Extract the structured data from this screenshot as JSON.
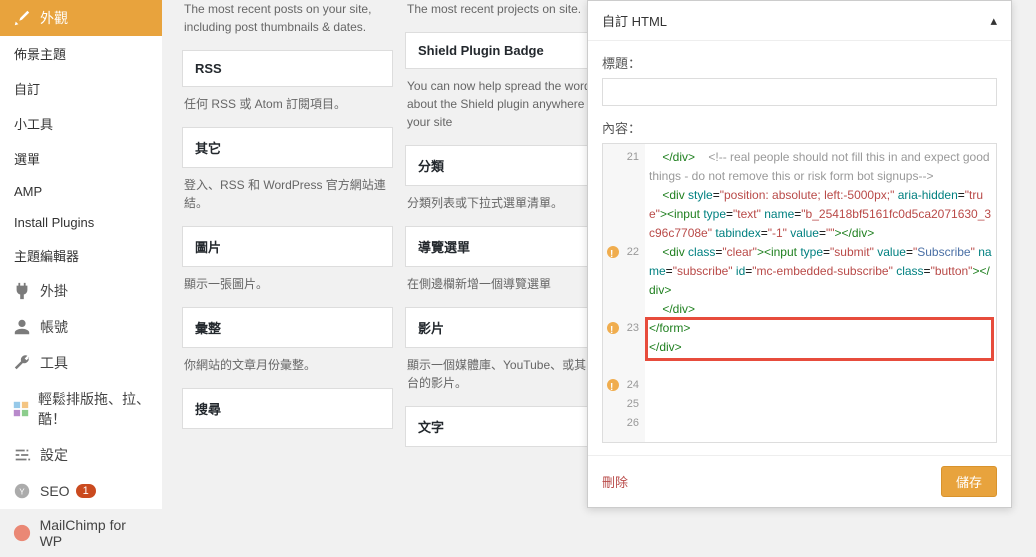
{
  "sidebar": {
    "appearance": "外觀",
    "sub": [
      "佈景主題",
      "自訂",
      "小工具",
      "選單",
      "AMP",
      "Install Plugins",
      "主題編輯器"
    ],
    "items": [
      {
        "icon": "plug",
        "label": "外掛"
      },
      {
        "icon": "user",
        "label": "帳號"
      },
      {
        "icon": "wrench",
        "label": "工具"
      },
      {
        "icon": "layout",
        "label": "輕鬆排版拖、拉、酷！"
      },
      {
        "icon": "sliders",
        "label": "設定"
      },
      {
        "icon": "seo",
        "label": "SEO",
        "badge": "1"
      },
      {
        "icon": "mailchimp",
        "label": "MailChimp for WP"
      }
    ]
  },
  "widgets": {
    "col1": [
      {
        "title": "",
        "desc": "The most recent posts on your site, including post thumbnails & dates."
      },
      {
        "title": "RSS",
        "desc": "任何 RSS 或 Atom 訂閱項目。"
      },
      {
        "title": "其它",
        "desc": "登入、RSS 和 WordPress 官方網站連結。"
      },
      {
        "title": "圖片",
        "desc": "顯示一張圖片。"
      },
      {
        "title": "彙整",
        "desc": "你網站的文章月份彙整。"
      },
      {
        "title": "搜尋",
        "desc": ""
      }
    ],
    "col2": [
      {
        "title": "",
        "desc": "The most recent projects on site."
      },
      {
        "title": "Shield Plugin Badge",
        "desc": "You can now help spread the word about the Shield plugin anywhere on your site"
      },
      {
        "title": "分類",
        "desc": "分類列表或下拉式選單清單。"
      },
      {
        "title": "導覽選單",
        "desc": "在側邊欄新增一個導覽選單"
      },
      {
        "title": "影片",
        "desc": "顯示一個媒體庫、YouTube、或其它平台的影片。"
      },
      {
        "title": "文字",
        "desc": ""
      }
    ]
  },
  "panel": {
    "title": "自訂 HTML",
    "label_title": "標題：",
    "label_content": "內容：",
    "delete": "刪除",
    "save": "儲存"
  },
  "code": {
    "lines": [
      21,
      22,
      23,
      24,
      25,
      26
    ]
  }
}
